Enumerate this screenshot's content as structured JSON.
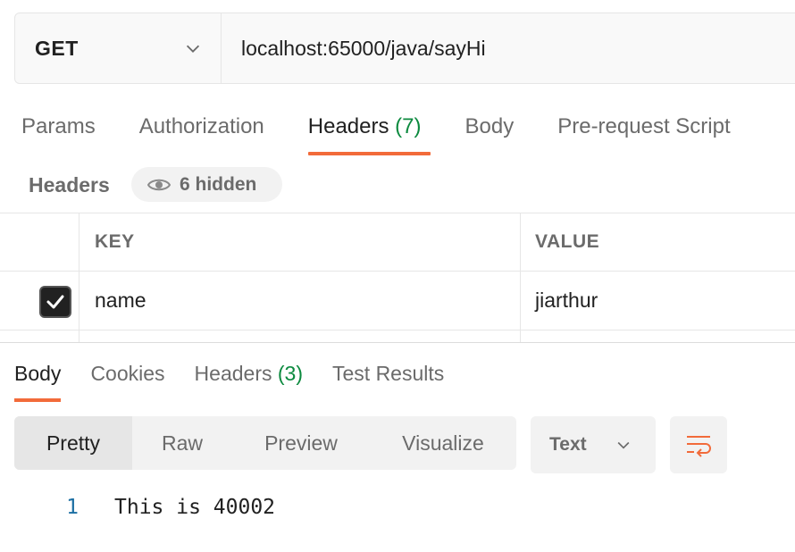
{
  "request": {
    "method": "GET",
    "url": "localhost:65000/java/sayHi"
  },
  "request_tabs": [
    {
      "label": "Params",
      "count": ""
    },
    {
      "label": "Authorization",
      "count": ""
    },
    {
      "label": "Headers",
      "count": "(7)",
      "active": true
    },
    {
      "label": "Body",
      "count": ""
    },
    {
      "label": "Pre-request Script",
      "count": ""
    }
  ],
  "headers_section": {
    "label": "Headers",
    "hidden_label": "6 hidden",
    "columns": {
      "key": "KEY",
      "value": "VALUE"
    },
    "rows": [
      {
        "checked": true,
        "key": "name",
        "value": "jiarthur"
      }
    ]
  },
  "response_tabs": [
    {
      "label": "Body",
      "count": "",
      "active": true
    },
    {
      "label": "Cookies",
      "count": ""
    },
    {
      "label": "Headers",
      "count": "(3)"
    },
    {
      "label": "Test Results",
      "count": ""
    }
  ],
  "view_modes": [
    "Pretty",
    "Raw",
    "Preview",
    "Visualize"
  ],
  "active_view": "Pretty",
  "format": "Text",
  "response_body": [
    {
      "line": "1",
      "text": "This is 40002"
    }
  ],
  "colors": {
    "accent": "#f26b3a",
    "count_green": "#0c8a3f",
    "line_number": "#1c6fa3"
  }
}
